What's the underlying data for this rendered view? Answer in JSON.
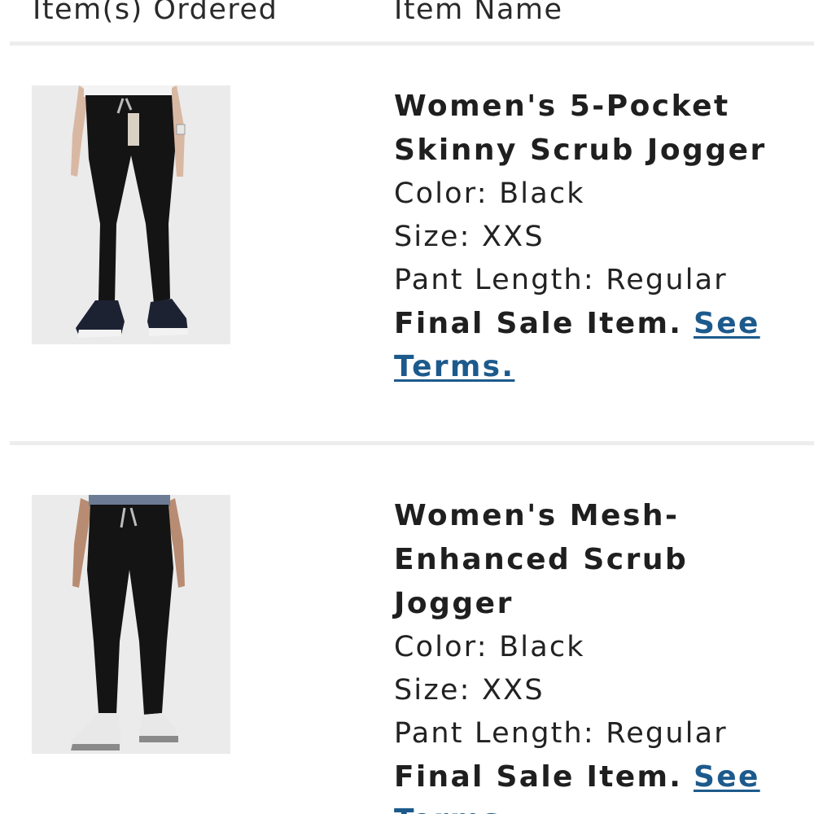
{
  "header": {
    "items_ordered_label": "Item(s) Ordered",
    "item_name_label": "Item Name"
  },
  "items": [
    {
      "title": "Women's 5-Pocket Skinny Scrub Jogger",
      "color": "Color: Black",
      "size": "Size: XXS",
      "pant_length": "Pant Length: Regular",
      "final_sale": "Final Sale Item.",
      "terms_link": "See Terms."
    },
    {
      "title": "Women's Mesh-Enhanced Scrub Jogger",
      "color": "Color: Black",
      "size": "Size: XXS",
      "pant_length": "Pant Length: Regular",
      "final_sale": "Final Sale Item.",
      "terms_link": "See Terms."
    }
  ],
  "colors": {
    "link": "#1d5a8c",
    "divider": "#ededed",
    "product_photo_bg": "#ebebeb",
    "garment": "#141414"
  }
}
